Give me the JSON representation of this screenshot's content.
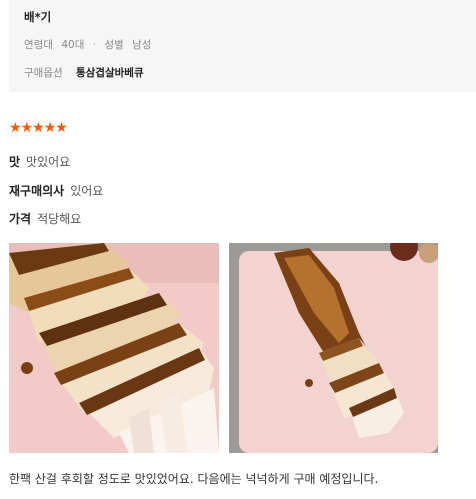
{
  "reviewer": {
    "name": "배*기",
    "age_label": "연령대",
    "age_value": "40대",
    "gender_label": "성별",
    "gender_value": "남성",
    "option_label": "구매옵션",
    "option_value": "통삼겹살바베큐"
  },
  "rating": {
    "stars": 5,
    "max": 5,
    "star_color": "#ff5a00"
  },
  "attributes": [
    {
      "key": "맛",
      "value": "맛있어요"
    },
    {
      "key": "재구매의사",
      "value": "있어요"
    },
    {
      "key": "가격",
      "value": "적당해요"
    }
  ],
  "photos": [
    {
      "icon": "grilled-pork-slices-photo"
    },
    {
      "icon": "grilled-pork-on-cutting-board-photo"
    }
  ],
  "review_text": "한팩 산걸 후회할 정도로 맛있었어요. 다음에는 넉넉하게 구매 예정입니다."
}
